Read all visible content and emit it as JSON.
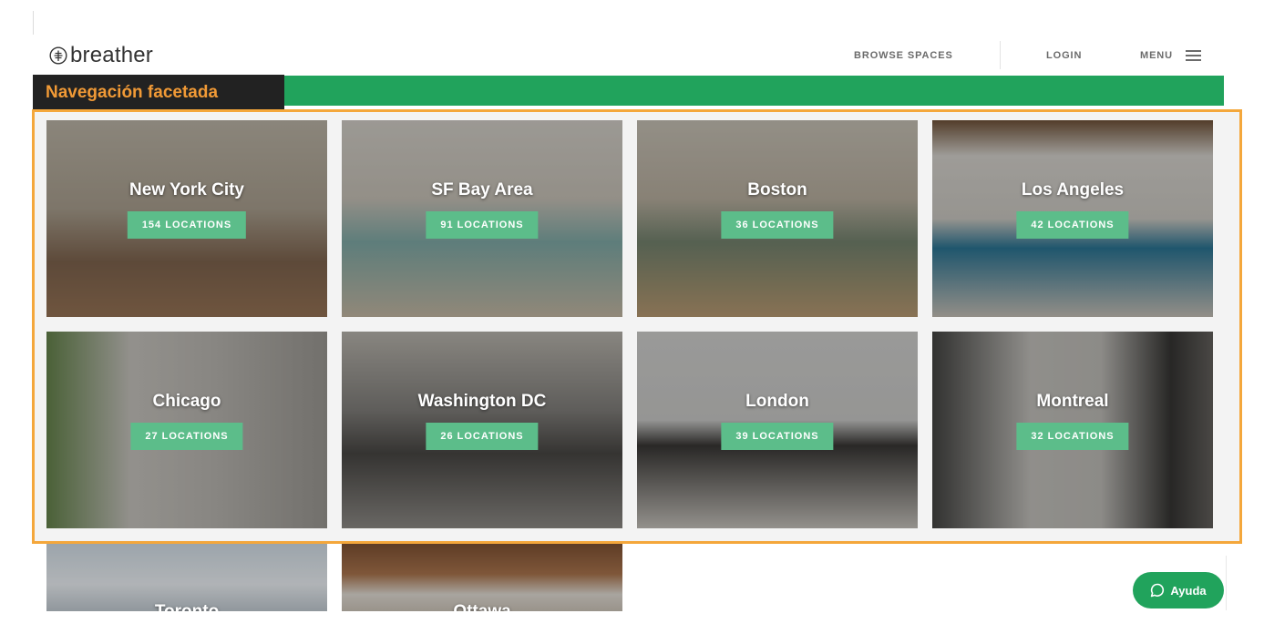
{
  "brand": {
    "name": "breather",
    "logo_icon": "tree-leaf-icon"
  },
  "nav": {
    "browse": "BROWSE SPACES",
    "login": "LOGIN",
    "menu": "MENU",
    "menu_icon": "hamburger-icon"
  },
  "annotation": {
    "label": "Navegación facetada"
  },
  "cities": [
    {
      "name": "New York City",
      "locations": "154 LOCATIONS"
    },
    {
      "name": "SF Bay Area",
      "locations": "91 LOCATIONS"
    },
    {
      "name": "Boston",
      "locations": "36 LOCATIONS"
    },
    {
      "name": "Los Angeles",
      "locations": "42 LOCATIONS"
    },
    {
      "name": "Chicago",
      "locations": "27 LOCATIONS"
    },
    {
      "name": "Washington DC",
      "locations": "26 LOCATIONS"
    },
    {
      "name": "London",
      "locations": "39 LOCATIONS"
    },
    {
      "name": "Montreal",
      "locations": "32 LOCATIONS"
    }
  ],
  "more_cities": [
    {
      "name": "Toronto"
    },
    {
      "name": "Ottawa"
    }
  ],
  "help": {
    "label": "Ayuda",
    "icon": "chat-bubble-icon"
  },
  "colors": {
    "brand_green": "#21a35c",
    "badge_green": "#5cbd8a",
    "highlight_orange": "#f4a73b",
    "label_orange": "#f19a36"
  }
}
